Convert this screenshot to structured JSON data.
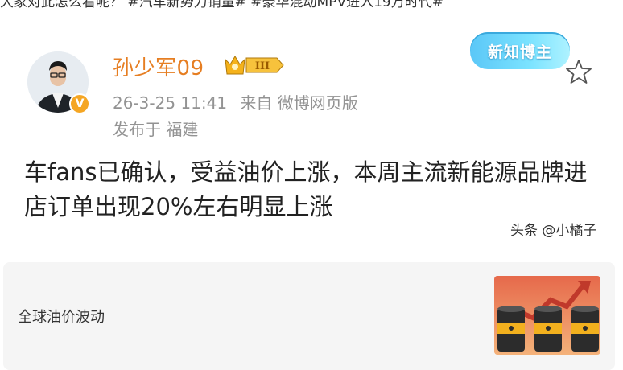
{
  "top_snippet": "大家对此怎么看呢？ #汽车新势力销量# #豪华混动MPV进入19万时代#",
  "author": {
    "name": "孙少军09",
    "level_badge": "III",
    "verified": "V"
  },
  "meta": {
    "date": "26-3-25 11:41",
    "source": "来自 微博网页版",
    "location": "发布于 福建"
  },
  "badge": "新知博主",
  "post": {
    "text": "车fans已确认，受益油价上涨，本周主流新能源品牌进店订单出现20%左右明显上涨"
  },
  "watermark": "头条 @小橘子",
  "card": {
    "title": "全球油价波动"
  },
  "colors": {
    "name": "#e67e22",
    "meta": "#939393",
    "card_bg": "#f5f5f5"
  }
}
